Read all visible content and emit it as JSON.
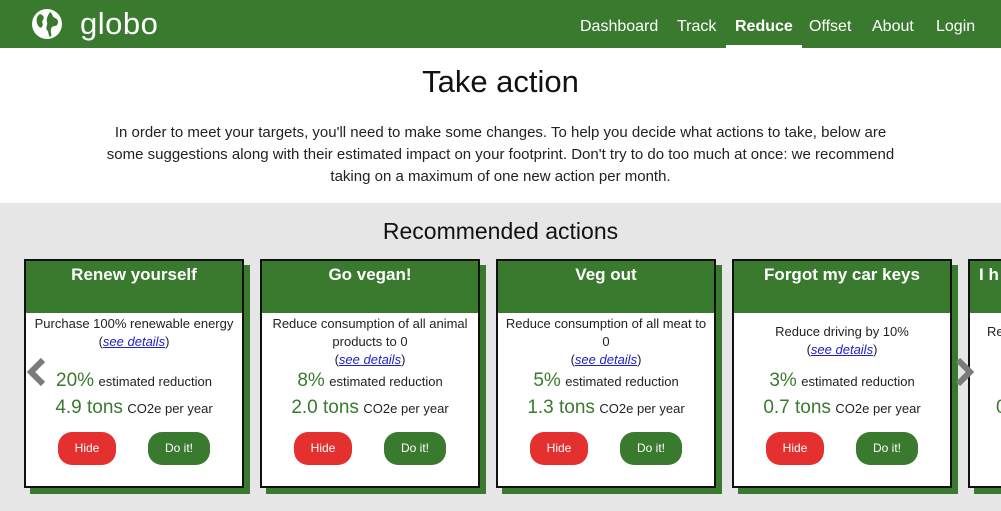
{
  "brand": {
    "name": "globo",
    "icon": "globe-icon"
  },
  "nav": {
    "items": [
      {
        "label": "Dashboard",
        "active": false
      },
      {
        "label": "Track",
        "active": false
      },
      {
        "label": "Reduce",
        "active": true
      },
      {
        "label": "Offset",
        "active": false
      },
      {
        "label": "About",
        "active": false
      },
      {
        "label": "Login",
        "active": false
      }
    ]
  },
  "page": {
    "title": "Take action",
    "intro": "In order to meet your targets, you'll need to make some changes. To help you decide what actions to take, below are some suggestions along with their estimated impact on your footprint. Don't try to do too much at once: we recommend taking on a maximum of one new action per month."
  },
  "recommended": {
    "title": "Recommended actions",
    "details_label": "see details",
    "reduction_suffix": "estimated reduction",
    "co2_suffix": "CO2e per year",
    "hide_label": "Hide",
    "do_label": "Do it!",
    "cards": [
      {
        "title": "Renew yourself",
        "description": "Purchase 100% renewable energy",
        "percent": "20%",
        "tons": "4.9 tons"
      },
      {
        "title": "Go vegan!",
        "description": "Reduce consumption of all animal products to 0",
        "percent": "8%",
        "tons": "2.0 tons"
      },
      {
        "title": "Veg out",
        "description": "Reduce consumption of all meat to 0",
        "percent": "5%",
        "tons": "1.3 tons"
      },
      {
        "title": "Forgot my car keys",
        "description": "Reduce driving by 10%",
        "percent": "3%",
        "tons": "0.7 tons"
      },
      {
        "title": "I h",
        "description": "Re",
        "percent": "0",
        "tons": ""
      }
    ]
  },
  "colors": {
    "primary": "#3a7a2e",
    "danger": "#e53030",
    "section_bg": "#e6e6e6",
    "link": "#2020c8"
  }
}
